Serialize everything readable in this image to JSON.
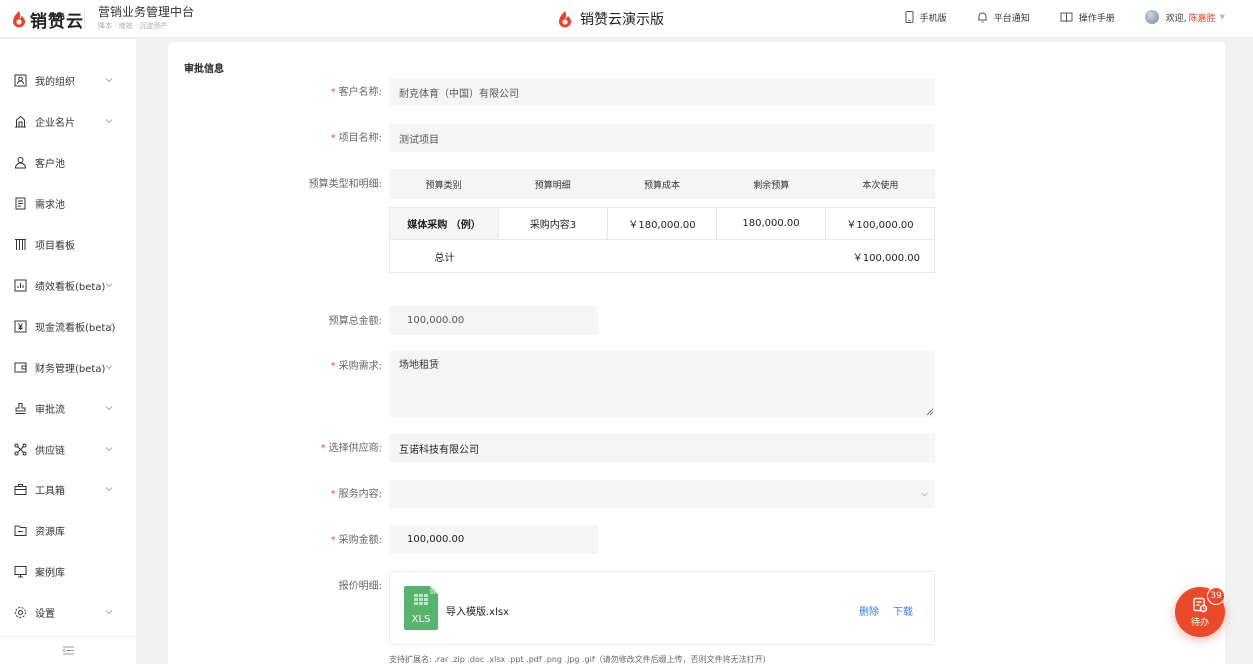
{
  "header": {
    "logo_text": "销赞云",
    "platform_title": "营销业务管理中台",
    "platform_subtitle": "降本 · 增效 · 沉淀资产",
    "center_title": "销赞云演示版",
    "mobile_label": "手机版",
    "notify_label": "平台通知",
    "manual_label": "操作手册",
    "welcome_prefix": "欢迎,",
    "user_name": "陈嘉胜"
  },
  "sidebar": {
    "items": [
      {
        "label": "我的组织",
        "icon": "org-icon",
        "has_arrow": true
      },
      {
        "label": "企业名片",
        "icon": "building-icon",
        "has_arrow": true
      },
      {
        "label": "客户池",
        "icon": "user-icon",
        "has_arrow": false
      },
      {
        "label": "需求池",
        "icon": "document-icon",
        "has_arrow": false
      },
      {
        "label": "项目看板",
        "icon": "kanban-icon",
        "has_arrow": false
      },
      {
        "label": "绩效看板(beta)",
        "icon": "chart-icon",
        "has_arrow": true
      },
      {
        "label": "现金流看板(beta)",
        "icon": "yen-icon",
        "has_arrow": true
      },
      {
        "label": "财务管理(beta)",
        "icon": "wallet-icon",
        "has_arrow": true
      },
      {
        "label": "审批流",
        "icon": "stamp-icon",
        "has_arrow": true
      },
      {
        "label": "供应链",
        "icon": "network-icon",
        "has_arrow": true
      },
      {
        "label": "工具箱",
        "icon": "toolbox-icon",
        "has_arrow": true
      },
      {
        "label": "资源库",
        "icon": "folder-icon",
        "has_arrow": false
      },
      {
        "label": "案例库",
        "icon": "monitor-icon",
        "has_arrow": false
      },
      {
        "label": "设置",
        "icon": "gear-icon",
        "has_arrow": true
      }
    ]
  },
  "form": {
    "section_title": "审批信息",
    "customer": {
      "label": "客户名称:",
      "value": "耐克体育（中国）有限公司"
    },
    "project": {
      "label": "项目名称:",
      "value": "测试项目"
    },
    "budget": {
      "label": "预算类型和明细:",
      "columns": [
        "预算类别",
        "预算明细",
        "预算成本",
        "剩余预算",
        "本次使用"
      ],
      "rows": [
        [
          "媒体采购 （例）",
          "采购内容3",
          "￥180,000.00",
          "180,000.00",
          "￥100,000.00"
        ]
      ],
      "total_label": "总计",
      "total_value": "￥100,000.00"
    },
    "budget_total": {
      "label": "预算总金额:",
      "value": "100,000.00"
    },
    "purchase_need": {
      "label": "采购需求:",
      "value": "场地租赁"
    },
    "supplier": {
      "label": "选择供应商:",
      "value": "互诺科技有限公司"
    },
    "service": {
      "label": "服务内容:",
      "value": ""
    },
    "purchase_amount": {
      "label": "采购金额:",
      "value": "100,000.00"
    },
    "quote": {
      "label": "报价明细:",
      "file_name": "导入模版.xlsx",
      "file_type": "XLS",
      "delete_label": "删除",
      "download_label": "下载"
    },
    "hint": "支持扩展名: .rar .zip .doc .xlsx .ppt .pdf .png .jpg .gif（请勿修改文件后缀上传，否则文件将无法打开）"
  },
  "todo": {
    "label": "待办",
    "count": "39"
  },
  "colors": {
    "brand": "#ea4a2c",
    "link": "#3b7ddd",
    "required": "#f04b3a"
  }
}
